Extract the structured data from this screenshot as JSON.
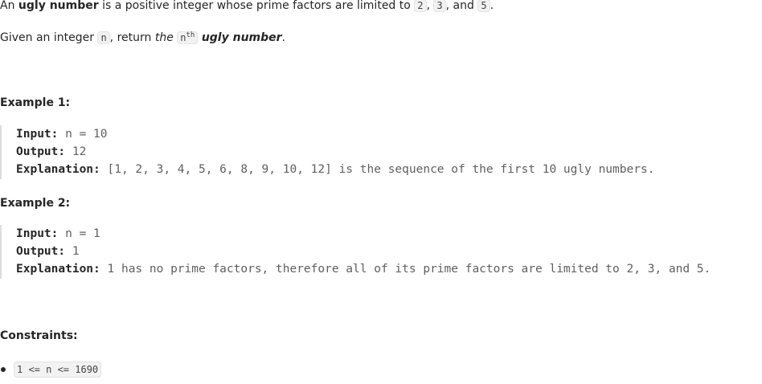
{
  "intro": {
    "part1": "An ",
    "term": "ugly number",
    "part2": " is a positive integer whose prime factors are limited to ",
    "factor_a": "2",
    "sep1": ", ",
    "factor_b": "3",
    "sep2": ", and ",
    "factor_c": "5",
    "end": "."
  },
  "task": {
    "part1": "Given an integer ",
    "var": "n",
    "part2": ", return ",
    "the": "the",
    "nth_base": "n",
    "nth_sup": "th",
    "term": "ugly number",
    "end": "."
  },
  "examples": [
    {
      "heading": "Example 1:",
      "input_label": "Input:",
      "input_value": "n = 10",
      "output_label": "Output:",
      "output_value": "12",
      "explanation_label": "Explanation:",
      "explanation_value": "[1, 2, 3, 4, 5, 6, 8, 9, 10, 12] is the sequence of the first 10 ugly numbers."
    },
    {
      "heading": "Example 2:",
      "input_label": "Input:",
      "input_value": "n = 1",
      "output_label": "Output:",
      "output_value": "1",
      "explanation_label": "Explanation:",
      "explanation_value": "1 has no prime factors, therefore all of its prime factors are limited to 2, 3, and 5."
    }
  ],
  "constraints": {
    "heading": "Constraints:",
    "items": [
      "1 <= n <= 1690"
    ]
  }
}
